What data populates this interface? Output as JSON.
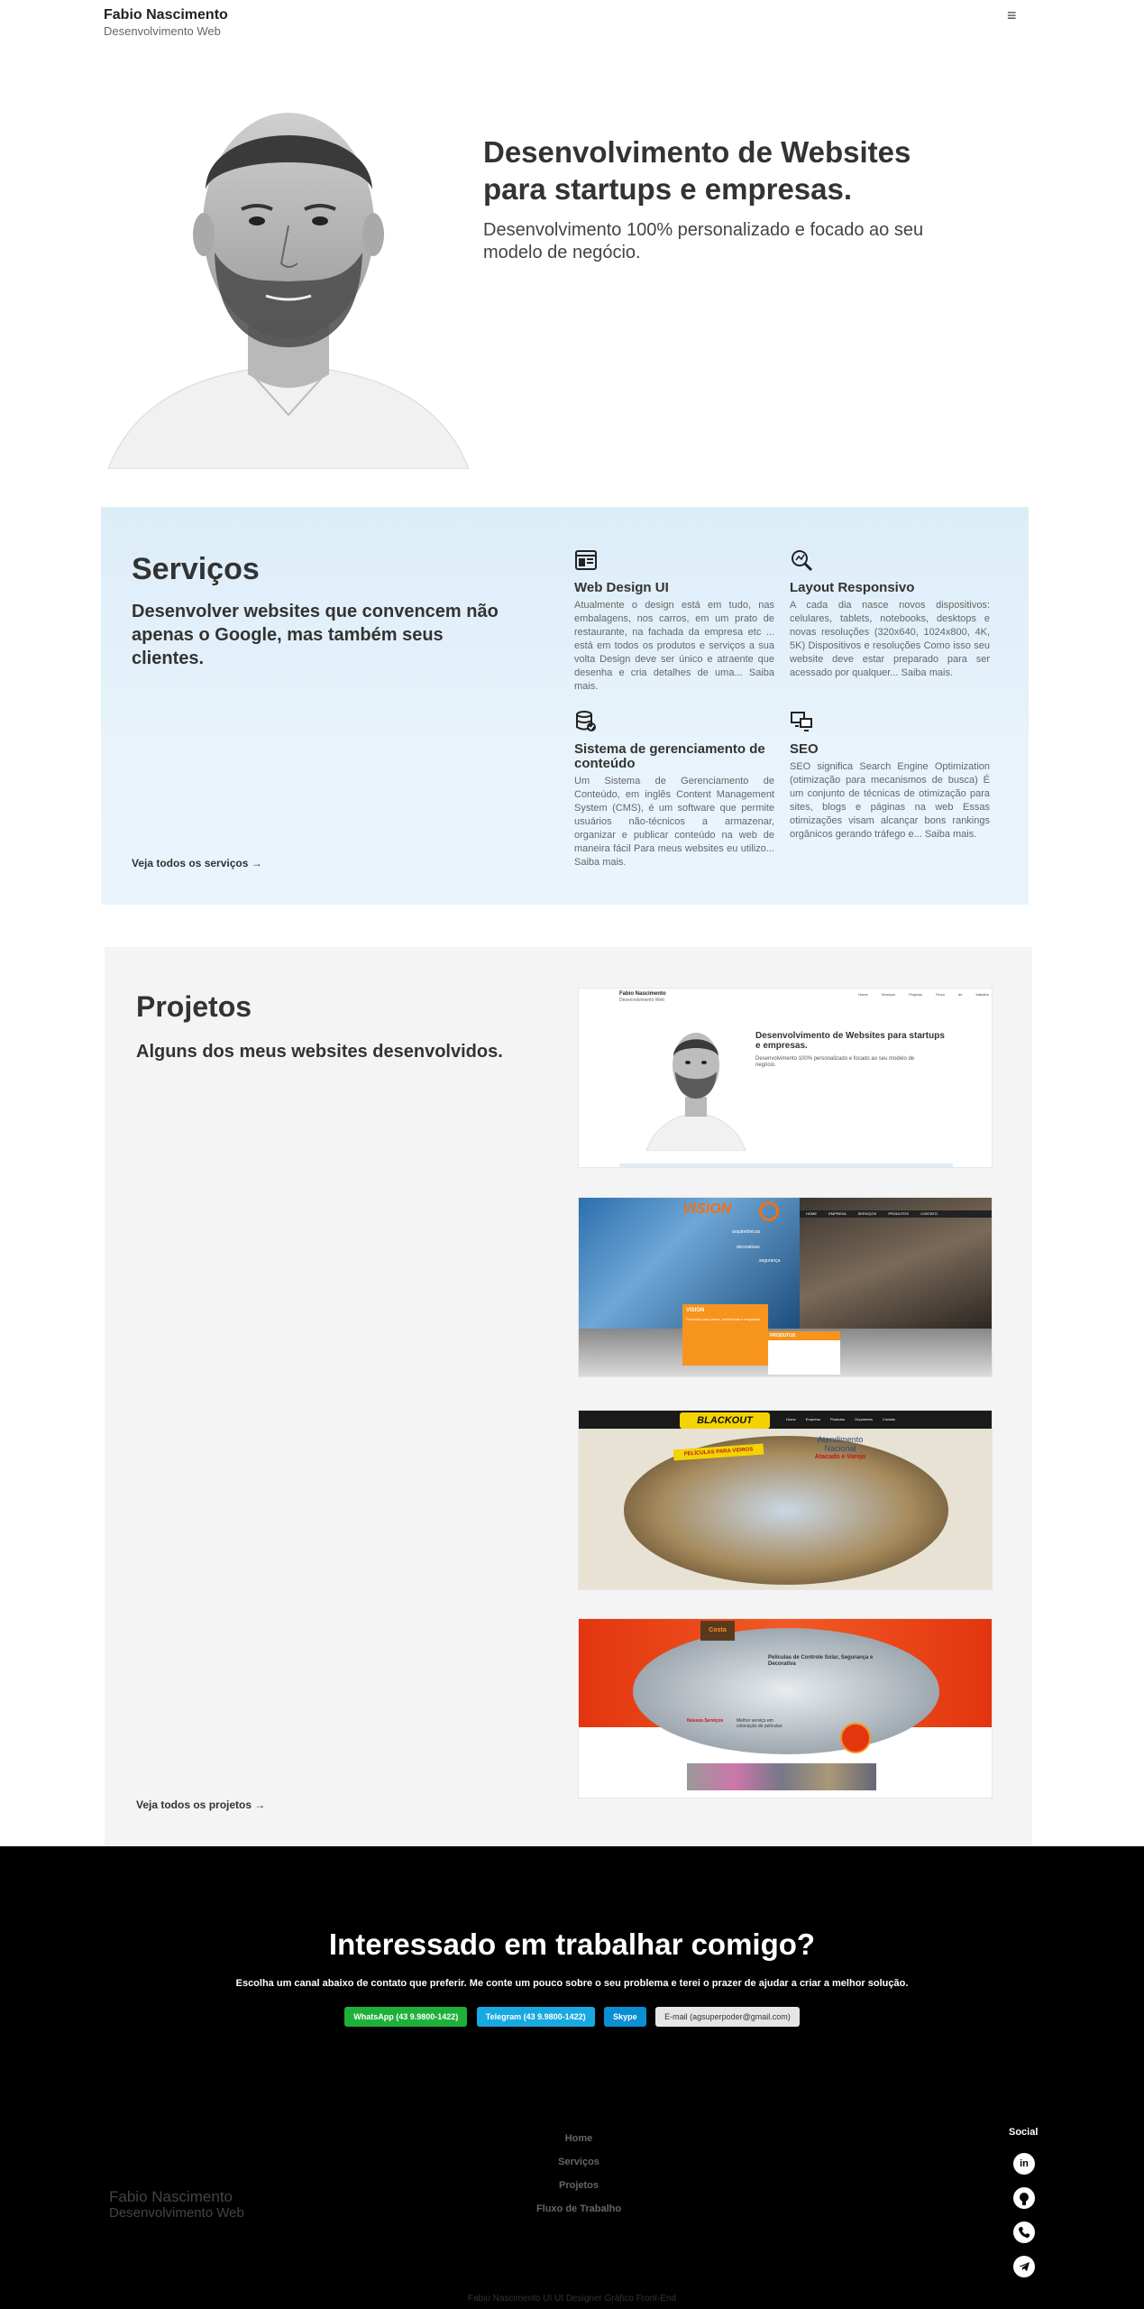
{
  "header": {
    "brand_name": "Fabio Nascimento",
    "brand_sub": "Desenvolvimento Web",
    "menu_icon": "hamburger-icon"
  },
  "hero": {
    "title": "Desenvolvimento de Websites para startups e empresas.",
    "subtitle": "Desenvolvimento 100% personalizado e focado ao seu modelo de negócio."
  },
  "services": {
    "title": "Serviços",
    "subtitle": "Desenvolver websites que convencem não apenas o Google, mas também seus clientes.",
    "link": "Veja todos os serviços →",
    "items": [
      {
        "icon": "browser-window-icon",
        "title": "Web Design UI",
        "desc": "Atualmente o design está em tudo, nas embalagens, nos carros, em um prato de restaurante, na fachada da empresa etc ... está em todos os produtos e serviços a sua volta Design deve ser único e atraente que desenha e cria detalhes de uma... Saiba mais."
      },
      {
        "icon": "magnify-code-icon",
        "title": "Layout Responsivo",
        "desc": "A cada dia nasce novos dispositivos: celulares, tablets, notebooks, desktops e novas resoluções (320x640, 1024x800, 4K, 5K) Dispositivos e resoluções Como isso seu website deve estar preparado para ser acessado por qualquer... Saiba mais."
      },
      {
        "icon": "database-check-icon",
        "title": "Sistema de gerenciamento de conteúdo",
        "desc": "Um Sistema de Gerenciamento de Conteúdo, em inglês Content Management System (CMS), é um software que permite usuários não-técnicos a armazenar, organizar e publicar conteúdo na web de maneira fácil Para meus websites eu utilizo... Saiba mais."
      },
      {
        "icon": "devices-icon",
        "title": "SEO",
        "desc": "SEO significa Search Engine Optimization (otimização para mecanismos de busca) É um conjunto de técnicas de otimização para sites, blogs e páginas na web Essas otimizações visam alcançar bons rankings orgânicos gerando tráfego e... Saiba mais."
      }
    ]
  },
  "projects": {
    "title": "Projetos",
    "subtitle": "Alguns dos meus websites desenvolvidos.",
    "link": "Veja todos os projetos →",
    "thumb1": {
      "brand": "Fabio Nascimento",
      "brand_sub": "Desenvolvimento Web",
      "nav": [
        "Home",
        "Serviços",
        "Projetos",
        "Fluxo de trabalho"
      ],
      "title": "Desenvolvimento de Websites para startups e empresas.",
      "subtitle": "Desenvolvimento 100% personalizado e focado ao seu modelo de negócio."
    },
    "thumb2": {
      "logo": "VISION",
      "nav": [
        "HOME",
        "EMPRESA",
        "SERVIÇOS",
        "PRODUTOS",
        "CONTATO"
      ],
      "box_title": "VISION",
      "box_text": "Películas para carros, residências e empresas",
      "products": "PRODUTOS",
      "tag1": "arquitetônicas",
      "tag2": "decorativas",
      "tag3": "segurança"
    },
    "thumb3": {
      "logo": "BLACKOUT",
      "nav": [
        "Home",
        "Empresa",
        "Produtos",
        "Orçamento",
        "Contato"
      ],
      "banner": "PELÍCULAS PARA VIDROS",
      "headline1": "Atendimento",
      "headline2": "Nacional",
      "headline3": "Atacado e Varejo"
    },
    "thumb4": {
      "logo": "Costa",
      "headline": "Películas de Controle Solar, Segurança e Decorativa",
      "label1": "Nossos Serviços",
      "label2": "Melhor serviço em colocação de películas"
    }
  },
  "contact": {
    "title": "Interessado em trabalhar comigo?",
    "subtitle": "Escolha um canal abaixo de contato que preferir. Me conte um pouco sobre o seu problema e terei o prazer de ajudar a criar a melhor solução.",
    "buttons": {
      "whatsapp": "WhatsApp (43 9.9800-1422)",
      "telegram": "Telegram (43 9.9800-1422)",
      "skype": "Skype",
      "email": "E-mail (agsuperpoder@gmail.com)"
    }
  },
  "footer": {
    "brand_name": "Fabio Nascimento",
    "brand_sub": "Desenvolvimento Web",
    "nav": [
      "Home",
      "Serviços",
      "Projetos",
      "Fluxo de Trabalho"
    ],
    "social_title": "Social",
    "social_icons": [
      "linkedin-icon",
      "github-icon",
      "phone-icon",
      "telegram-icon"
    ],
    "credit": "Fabio Nascimento UI UI Designer Gráfico Front-End"
  },
  "colors": {
    "services_bg": "#e3f0fa",
    "projects_bg": "#f4f4f4",
    "contact_bg": "#000000",
    "whatsapp": "#1fb03a",
    "telegram": "#18a9e0",
    "skype": "#0a8fd2"
  }
}
